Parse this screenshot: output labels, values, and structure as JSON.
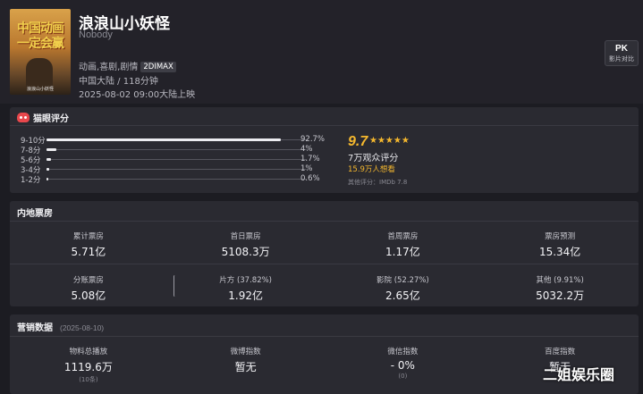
{
  "movie": {
    "poster_text": "中国动画一定会赢",
    "poster_footer": "浪浪山小妖怪",
    "title": "浪浪山小妖怪",
    "english_title": "Nobody",
    "genres": "动画,喜剧,剧情",
    "format_badge": "2DIMAX",
    "region_duration": "中国大陆 / 118分钟",
    "release": "2025-08-02 09:00大陆上映"
  },
  "pk_button": {
    "main": "PK",
    "sub": "影片对比"
  },
  "rating": {
    "section_title": "猫眼评分",
    "distribution": [
      {
        "label": "9-10分",
        "percent": 92.7,
        "text": "92.7%"
      },
      {
        "label": "7-8分",
        "percent": 4,
        "text": "4%"
      },
      {
        "label": "5-6分",
        "percent": 1.7,
        "text": "1.7%"
      },
      {
        "label": "3-4分",
        "percent": 1,
        "text": "1%"
      },
      {
        "label": "1-2分",
        "percent": 0.6,
        "text": "0.6%"
      }
    ],
    "score": "9.7",
    "stars": "★★★★★",
    "viewers": "7万观众评分",
    "wish": "15.9万人想看",
    "other_rating": "其他评分：IMDb 7.8"
  },
  "box_office": {
    "section_title": "内地票房",
    "row1": [
      {
        "label": "累计票房",
        "value": "5.71亿"
      },
      {
        "label": "首日票房",
        "value": "5108.3万"
      },
      {
        "label": "首周票房",
        "value": "1.17亿"
      },
      {
        "label": "票房预测",
        "value": "15.34亿"
      }
    ],
    "row2": [
      {
        "label": "分账票房",
        "value": "5.08亿"
      },
      {
        "label": "片方 (37.82%)",
        "value": "1.92亿"
      },
      {
        "label": "影院 (52.27%)",
        "value": "2.65亿"
      },
      {
        "label": "其他 (9.91%)",
        "value": "5032.2万"
      }
    ]
  },
  "marketing": {
    "section_title": "营销数据",
    "date": "(2025-08-10)",
    "items": [
      {
        "label": "物料总播放",
        "value": "1119.6万",
        "sub": "(10条)"
      },
      {
        "label": "微博指数",
        "value": "暂无",
        "sub": ""
      },
      {
        "label": "微信指数",
        "value": "- 0%",
        "sub": "(0)"
      },
      {
        "label": "百度指数",
        "value": "暂无",
        "sub": ""
      }
    ]
  },
  "watermark": "二姐娱乐圈",
  "colors": {
    "accent_gold": "#f5b82e",
    "cat_red": "#e8474c",
    "background": "#1c1c22",
    "panel": "#2a2a31"
  }
}
